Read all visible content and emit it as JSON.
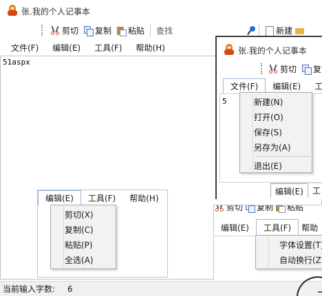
{
  "main": {
    "title": "张.我的个人记事本",
    "toolbar": {
      "cut": "剪切",
      "copy": "复制",
      "paste": "粘贴",
      "find": "查找",
      "new": "新建"
    },
    "menu": [
      "文件(F)",
      "编辑(E)",
      "工具(F)",
      "帮助(H)"
    ],
    "content": "51aspx",
    "status_label": "当前输入字数:",
    "status_value": "6"
  },
  "win_file": {
    "title": "张.我的个人记事本",
    "toolbar": {
      "cut": "剪切",
      "copy": "复制"
    },
    "menu": [
      "文件(F)",
      "编辑(E)",
      "工具"
    ],
    "dropdown": [
      "新建(N)",
      "打开(O)",
      "保存(S)",
      "另存为(A)",
      "退出(E)"
    ],
    "content_char": "5",
    "bottom_tab": "编辑(E)",
    "bottom_tab2": "工"
  },
  "win_edit": {
    "menu": [
      "编辑(E)",
      "工具(F)",
      "帮助(H)"
    ],
    "dropdown": [
      "剪切(X)",
      "复制(C)",
      "粘贴(P)",
      "全选(A)"
    ]
  },
  "win_tools": {
    "toolbar": {
      "cut": "剪切",
      "copy": "复制",
      "paste": "粘贴"
    },
    "menu": [
      "编辑(E)",
      "工具(F)",
      "帮助"
    ],
    "dropdown": [
      "字体设置(T)",
      "自动换行(Z)"
    ]
  }
}
